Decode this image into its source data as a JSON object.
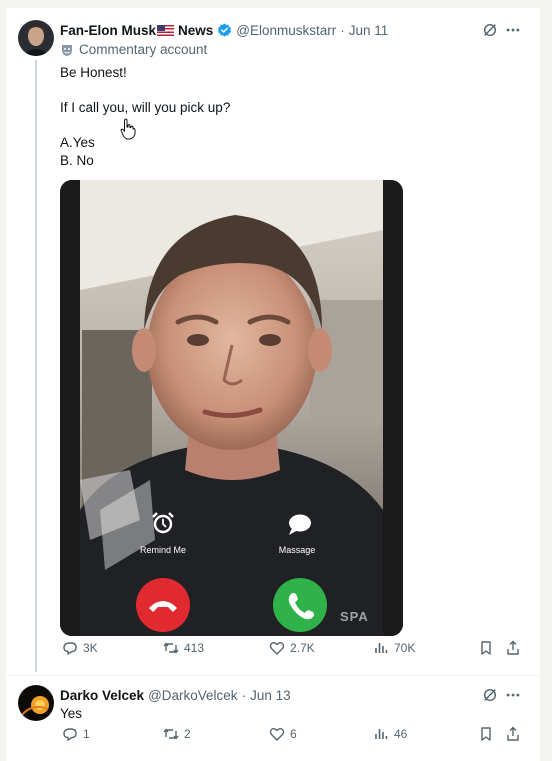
{
  "post": {
    "name_part1": "Fan-Elon Musk",
    "name_part2": "News",
    "handle": "@Elonmuskstarr",
    "separator": "·",
    "date": "Jun 11",
    "commentary_label": "Commentary account",
    "text_line1": "Be Honest!",
    "text_line2": "If I call you, will you pick up?",
    "text_line3": "A.Yes",
    "text_line4": "B. No",
    "media": {
      "remind_label": "Remind Me",
      "message_label": "Massage",
      "corner_text": "SPA"
    },
    "stats": {
      "replies": "3K",
      "reposts": "413",
      "likes": "2.7K",
      "views": "70K"
    }
  },
  "reply": {
    "name": "Darko Velcek",
    "handle": "@DarkoVelcek",
    "separator": "·",
    "date": "Jun 13",
    "text": "Yes",
    "stats": {
      "replies": "1",
      "reposts": "2",
      "likes": "6",
      "views": "46"
    }
  },
  "colors": {
    "verified": "#1d9bf0",
    "decline": "#e02a30",
    "accept": "#2fb24a",
    "muted": "#536471"
  }
}
